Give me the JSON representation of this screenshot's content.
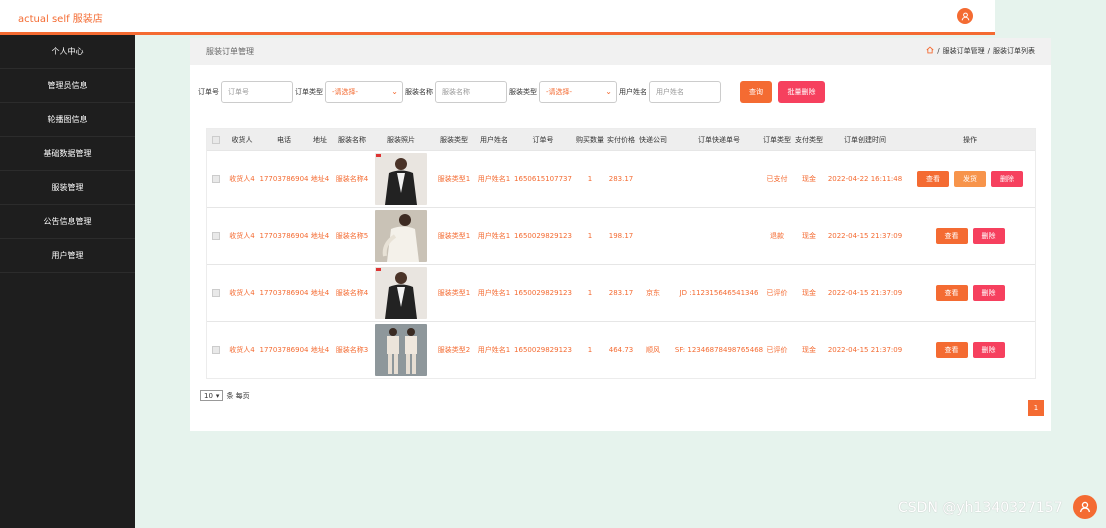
{
  "app": {
    "title": "actual self 服装店"
  },
  "colors": {
    "accent": "#f46b32",
    "danger": "#f6405e",
    "sidebar_bg": "#1e1e1e"
  },
  "sidebar": {
    "items": [
      {
        "label": "个人中心"
      },
      {
        "label": "管理员信息"
      },
      {
        "label": "轮播图信息"
      },
      {
        "label": "基础数据管理"
      },
      {
        "label": "服装管理"
      },
      {
        "label": "公告信息管理"
      },
      {
        "label": "用户管理"
      }
    ]
  },
  "header": {
    "page_title": "服装订单管理",
    "breadcrumb": [
      "服装订单管理",
      "服装订单列表"
    ],
    "breadcrumb_sep": "/",
    "home_icon": "home-icon"
  },
  "search": {
    "order_no_label": "订单号",
    "order_no_placeholder": "订单号",
    "order_type_label": "订单类型",
    "order_type_value": "-请选择-",
    "clothes_name_label": "服装名称",
    "clothes_name_placeholder": "服装名称",
    "clothes_type_label": "服装类型",
    "clothes_type_value": "-请选择-",
    "user_name_label": "用户姓名",
    "user_name_placeholder": "用户姓名",
    "query_button": "查询",
    "batch_delete_button": "批量删除"
  },
  "table": {
    "columns": [
      "收货人",
      "电话",
      "地址",
      "服装名称",
      "服装照片",
      "服装类型",
      "用户姓名",
      "订单号",
      "购买数量",
      "实付价格",
      "快递公司",
      "订单快递单号",
      "订单类型",
      "支付类型",
      "订单创建时间",
      "操作"
    ],
    "rows": [
      {
        "receiver": "收货人4",
        "phone": "17703786904",
        "address": "地址4",
        "name": "服装名称4",
        "photo": "dark-jacket",
        "type": "服装类型1",
        "user": "用户姓名1",
        "order_no": "1650615107737",
        "qty": "1",
        "price": "283.17",
        "courier": "",
        "tracking": "",
        "status": "已支付",
        "pay": "现金",
        "created": "2022-04-22 16:11:48",
        "ops": [
          "查看",
          "发货",
          "删除"
        ]
      },
      {
        "receiver": "收货人4",
        "phone": "17703786904",
        "address": "地址4",
        "name": "服装名称5",
        "photo": "light-cardigan",
        "type": "服装类型1",
        "user": "用户姓名1",
        "order_no": "1650029829123",
        "qty": "1",
        "price": "198.17",
        "courier": "",
        "tracking": "",
        "status": "退款",
        "pay": "现金",
        "created": "2022-04-15 21:37:09",
        "ops": [
          "查看",
          "删除"
        ]
      },
      {
        "receiver": "收货人4",
        "phone": "17703786904",
        "address": "地址4",
        "name": "服装名称4",
        "photo": "dark-jacket",
        "type": "服装类型1",
        "user": "用户姓名1",
        "order_no": "1650029829123",
        "qty": "1",
        "price": "283.17",
        "courier": "京东",
        "tracking": "JD :112315646541346",
        "status": "已评价",
        "pay": "现金",
        "created": "2022-04-15 21:37:09",
        "ops": [
          "查看",
          "删除"
        ]
      },
      {
        "receiver": "收货人4",
        "phone": "17703786904",
        "address": "地址4",
        "name": "服装名称3",
        "photo": "two-piece-set",
        "type": "服装类型2",
        "user": "用户姓名1",
        "order_no": "1650029829123",
        "qty": "1",
        "price": "464.73",
        "courier": "顺风",
        "tracking": "SF: 12346878498765468",
        "status": "已评价",
        "pay": "现金",
        "created": "2022-04-15 21:37:09",
        "ops": [
          "查看",
          "删除"
        ]
      }
    ]
  },
  "pager": {
    "page_size": "10",
    "per_page_label": "条 每页",
    "current_page": "1"
  },
  "watermark": "CSDN @yh1340327157"
}
